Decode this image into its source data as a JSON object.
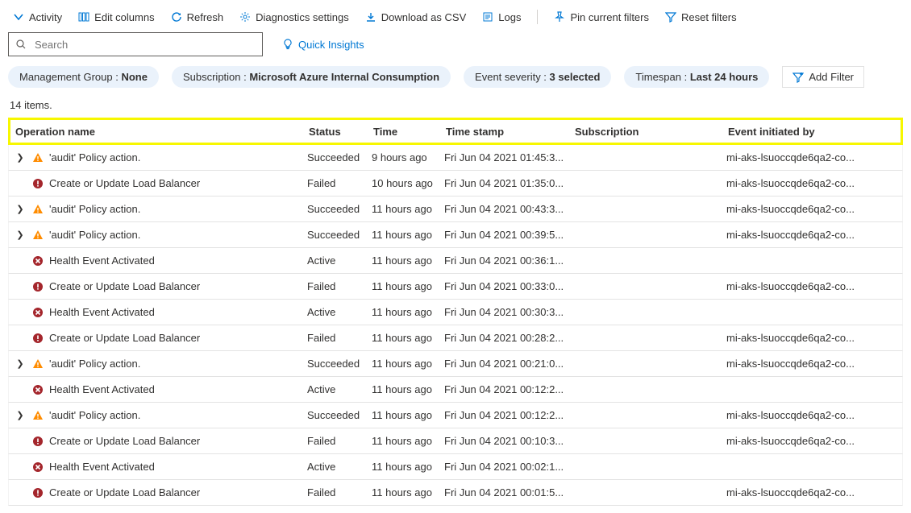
{
  "toolbar": {
    "activity": "Activity",
    "edit_columns": "Edit columns",
    "refresh": "Refresh",
    "diagnostics": "Diagnostics settings",
    "download_csv": "Download as CSV",
    "logs": "Logs",
    "pin_filters": "Pin current filters",
    "reset_filters": "Reset filters"
  },
  "search": {
    "placeholder": "Search"
  },
  "quick_insights": "Quick Insights",
  "pills": {
    "mg_label": "Management Group : ",
    "mg_value": "None",
    "sub_label": "Subscription : ",
    "sub_value": "Microsoft Azure Internal Consumption",
    "sev_label": "Event severity : ",
    "sev_value": "3 selected",
    "span_label": "Timespan : ",
    "span_value": "Last 24 hours",
    "add_filter": "Add Filter"
  },
  "count_text": "14 items.",
  "headers": {
    "op": "Operation name",
    "status": "Status",
    "time": "Time",
    "timestamp": "Time stamp",
    "subscription": "Subscription",
    "initiated_by": "Event initiated by"
  },
  "rows": [
    {
      "expand": true,
      "icon": "warn",
      "op": "'audit' Policy action.",
      "status": "Succeeded",
      "time": "9 hours ago",
      "ts": "Fri Jun 04 2021 01:45:3...",
      "sub": "",
      "by": "mi-aks-lsuoccqde6qa2-co..."
    },
    {
      "expand": false,
      "icon": "error",
      "op": "Create or Update Load Balancer",
      "status": "Failed",
      "time": "10 hours ago",
      "ts": "Fri Jun 04 2021 01:35:0...",
      "sub": "",
      "by": "mi-aks-lsuoccqde6qa2-co..."
    },
    {
      "expand": true,
      "icon": "warn",
      "op": "'audit' Policy action.",
      "status": "Succeeded",
      "time": "11 hours ago",
      "ts": "Fri Jun 04 2021 00:43:3...",
      "sub": "",
      "by": "mi-aks-lsuoccqde6qa2-co..."
    },
    {
      "expand": true,
      "icon": "warn",
      "op": "'audit' Policy action.",
      "status": "Succeeded",
      "time": "11 hours ago",
      "ts": "Fri Jun 04 2021 00:39:5...",
      "sub": "",
      "by": "mi-aks-lsuoccqde6qa2-co..."
    },
    {
      "expand": false,
      "icon": "x",
      "op": "Health Event Activated",
      "status": "Active",
      "time": "11 hours ago",
      "ts": "Fri Jun 04 2021 00:36:1...",
      "sub": "",
      "by": ""
    },
    {
      "expand": false,
      "icon": "error",
      "op": "Create or Update Load Balancer",
      "status": "Failed",
      "time": "11 hours ago",
      "ts": "Fri Jun 04 2021 00:33:0...",
      "sub": "",
      "by": "mi-aks-lsuoccqde6qa2-co..."
    },
    {
      "expand": false,
      "icon": "x",
      "op": "Health Event Activated",
      "status": "Active",
      "time": "11 hours ago",
      "ts": "Fri Jun 04 2021 00:30:3...",
      "sub": "",
      "by": ""
    },
    {
      "expand": false,
      "icon": "error",
      "op": "Create or Update Load Balancer",
      "status": "Failed",
      "time": "11 hours ago",
      "ts": "Fri Jun 04 2021 00:28:2...",
      "sub": "",
      "by": "mi-aks-lsuoccqde6qa2-co..."
    },
    {
      "expand": true,
      "icon": "warn",
      "op": "'audit' Policy action.",
      "status": "Succeeded",
      "time": "11 hours ago",
      "ts": "Fri Jun 04 2021 00:21:0...",
      "sub": "",
      "by": "mi-aks-lsuoccqde6qa2-co..."
    },
    {
      "expand": false,
      "icon": "x",
      "op": "Health Event Activated",
      "status": "Active",
      "time": "11 hours ago",
      "ts": "Fri Jun 04 2021 00:12:2...",
      "sub": "",
      "by": ""
    },
    {
      "expand": true,
      "icon": "warn",
      "op": "'audit' Policy action.",
      "status": "Succeeded",
      "time": "11 hours ago",
      "ts": "Fri Jun 04 2021 00:12:2...",
      "sub": "",
      "by": "mi-aks-lsuoccqde6qa2-co..."
    },
    {
      "expand": false,
      "icon": "error",
      "op": "Create or Update Load Balancer",
      "status": "Failed",
      "time": "11 hours ago",
      "ts": "Fri Jun 04 2021 00:10:3...",
      "sub": "",
      "by": "mi-aks-lsuoccqde6qa2-co..."
    },
    {
      "expand": false,
      "icon": "x",
      "op": "Health Event Activated",
      "status": "Active",
      "time": "11 hours ago",
      "ts": "Fri Jun 04 2021 00:02:1...",
      "sub": "",
      "by": ""
    },
    {
      "expand": false,
      "icon": "error",
      "op": "Create or Update Load Balancer",
      "status": "Failed",
      "time": "11 hours ago",
      "ts": "Fri Jun 04 2021 00:01:5...",
      "sub": "",
      "by": "mi-aks-lsuoccqde6qa2-co..."
    }
  ]
}
